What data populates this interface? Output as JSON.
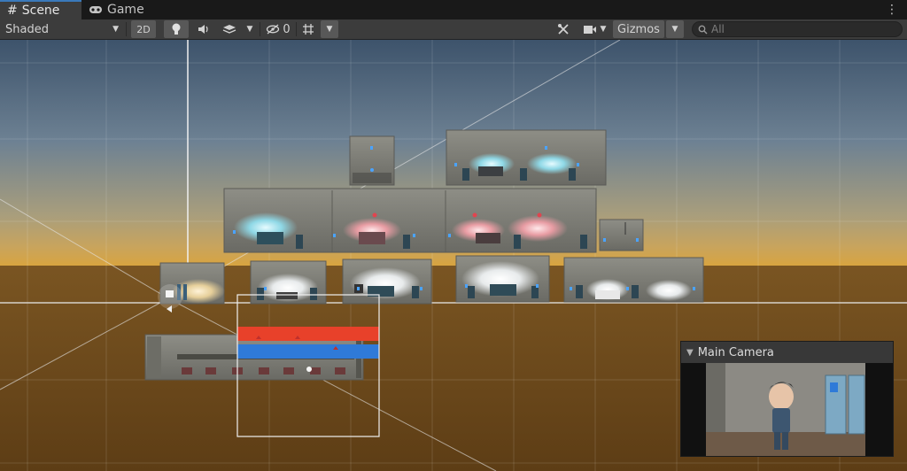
{
  "tabs": [
    {
      "label": "Scene",
      "icon": "hash-icon",
      "active": true
    },
    {
      "label": "Game",
      "icon": "gamepad-icon",
      "active": false
    }
  ],
  "toolbar": {
    "shading_mode": "Shaded",
    "mode_2d": "2D",
    "hidden_count": "0",
    "gizmos_label": "Gizmos",
    "search_placeholder": "All"
  },
  "camera_preview": {
    "title": "Main Camera"
  },
  "colors": {
    "accent_tab": "#3a79bb",
    "red_bar": "#e8412a",
    "blue_bar": "#2f7ad8"
  }
}
